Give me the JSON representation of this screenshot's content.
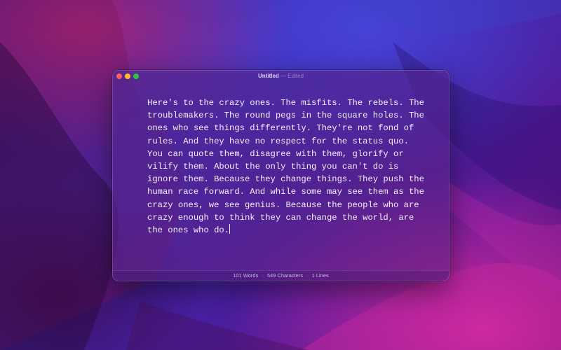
{
  "window": {
    "title": "Untitled",
    "title_separator": "—",
    "status_text": "Edited",
    "traffic_lights": {
      "close": "#ff5f57",
      "minimize": "#febc2e",
      "maximize": "#28c840"
    }
  },
  "editor": {
    "lines": [
      "Here's to the crazy ones. The misfits. The rebels. The",
      "troublemakers. The round pegs in the square holes. The",
      "ones who see things differently. They're not fond of",
      "rules. And they have no respect for the status quo.",
      "You can quote them, disagree with them, glorify or",
      "vilify them. About the only thing you can't do is",
      "ignore them. Because they change things. They push the",
      "human race forward. And while some may see them as the",
      "crazy ones, we see genius. Because the people who are",
      "crazy enough to think they can change the world, are",
      "the ones who do."
    ]
  },
  "statusbar": {
    "words": "101 Words",
    "characters": "549 Characters",
    "lines": "1 Lines",
    "separator": "·"
  }
}
